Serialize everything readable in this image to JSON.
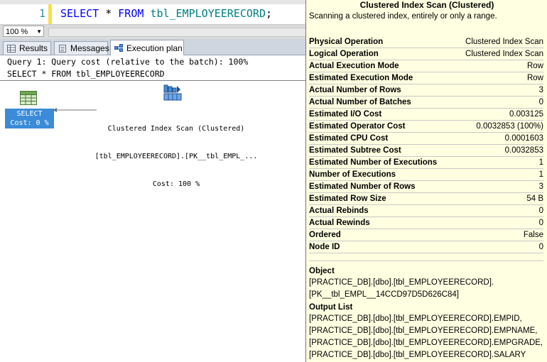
{
  "editor": {
    "line_number": "1",
    "sql": {
      "select": "SELECT",
      "star": " * ",
      "from": "FROM",
      "space": " ",
      "table": "tbl_EMPLOYEERECORD",
      "semicolon": ";"
    }
  },
  "zoom": {
    "value": "100 %"
  },
  "tabs": [
    {
      "label": "Results"
    },
    {
      "label": "Messages"
    },
    {
      "label": "Execution plan",
      "active": true
    }
  ],
  "plan": {
    "query_header": "Query 1: Query cost (relative to the batch): 100%",
    "query_text": "SELECT * FROM tbl_EMPLOYEERECORD",
    "select_node": {
      "label": "SELECT",
      "cost": "Cost: 0 %"
    },
    "scan_node": {
      "line1": "Clustered Index Scan (Clustered)",
      "line2": "[tbl_EMPLOYEERECORD].[PK__tbl_EMPL_...",
      "line3": "Cost: 100 %"
    }
  },
  "tooltip": {
    "title": "Clustered Index Scan (Clustered)",
    "description": "Scanning a clustered index, entirely or only a range.",
    "rows": [
      {
        "label": "Physical Operation",
        "value": "Clustered Index Scan"
      },
      {
        "label": "Logical Operation",
        "value": "Clustered Index Scan"
      },
      {
        "label": "Actual Execution Mode",
        "value": "Row"
      },
      {
        "label": "Estimated Execution Mode",
        "value": "Row"
      },
      {
        "label": "Actual Number of Rows",
        "value": "3"
      },
      {
        "label": "Actual Number of Batches",
        "value": "0"
      },
      {
        "label": "Estimated I/O Cost",
        "value": "0.003125"
      },
      {
        "label": "Estimated Operator Cost",
        "value": "0.0032853 (100%)"
      },
      {
        "label": "Estimated CPU Cost",
        "value": "0.0001603"
      },
      {
        "label": "Estimated Subtree Cost",
        "value": "0.0032853"
      },
      {
        "label": "Estimated Number of Executions",
        "value": "1"
      },
      {
        "label": "Number of Executions",
        "value": "1"
      },
      {
        "label": "Estimated Number of Rows",
        "value": "3"
      },
      {
        "label": "Estimated Row Size",
        "value": "54 B"
      },
      {
        "label": "Actual Rebinds",
        "value": "0"
      },
      {
        "label": "Actual Rewinds",
        "value": "0"
      },
      {
        "label": "Ordered",
        "value": "False"
      },
      {
        "label": "Node ID",
        "value": "0"
      }
    ],
    "object": {
      "heading": "Object",
      "lines": [
        "[PRACTICE_DB].[dbo].[tbl_EMPLOYEERECORD].",
        "[PK__tbl_EMPL__14CCD97D5D626C84]"
      ]
    },
    "output_list": {
      "heading": "Output List",
      "lines": [
        "[PRACTICE_DB].[dbo].[tbl_EMPLOYEERECORD].EMPID,",
        "[PRACTICE_DB].[dbo].[tbl_EMPLOYEERECORD].EMPNAME,",
        "[PRACTICE_DB].[dbo].[tbl_EMPLOYEERECORD].EMPGRADE,",
        "[PRACTICE_DB].[dbo].[tbl_EMPLOYEERECORD].SALARY"
      ]
    }
  },
  "colors": {
    "keyword": "#0000ff",
    "table_name": "#008080",
    "line_number": "#2b91af",
    "select_node_bg": "#3a8bd8",
    "tooltip_bg": "#ffffe1"
  }
}
